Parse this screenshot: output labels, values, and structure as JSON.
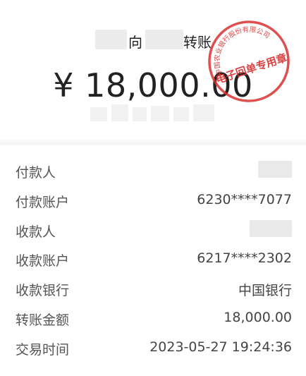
{
  "header": {
    "title_left": "向",
    "title_right": "转账",
    "amount": "¥ 18,000.00"
  },
  "stamp": {
    "arc_text": "中国农业银行股份有限公司",
    "center_text": "电子回单专用章",
    "color": "#d9302f"
  },
  "details": {
    "payer_label": "付款人",
    "payer_account_label": "付款账户",
    "payer_account": "6230****7077",
    "payee_label": "收款人",
    "payee_account_label": "收款账户",
    "payee_account": "6217****2302",
    "payee_bank_label": "收款银行",
    "payee_bank": "中国银行",
    "amount_label": "转账金额",
    "amount": "18,000.00",
    "time_label": "交易时间",
    "time": "2023-05-27 19:24:36"
  }
}
